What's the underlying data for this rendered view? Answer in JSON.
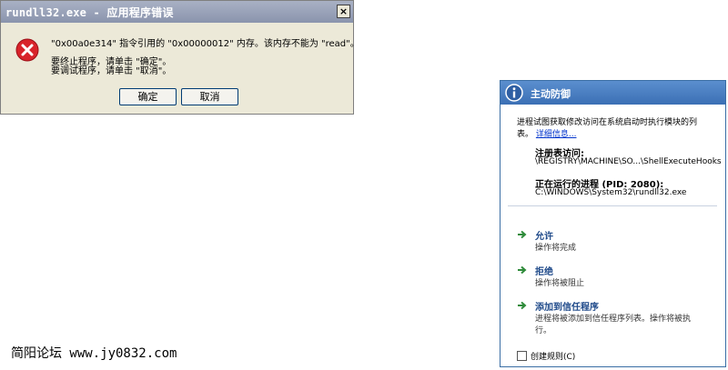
{
  "error_dialog": {
    "title": "rundll32.exe - 应用程序错误",
    "close_glyph": "×",
    "message": "\"0x00a0e314\" 指令引用的 \"0x00000012\" 内存。该内存不能为 \"read\"。",
    "line_terminate": "要终止程序，请单击 \"确定\"。",
    "line_debug": "要调试程序，请单击 \"取消\"。",
    "ok_label": "确定",
    "cancel_label": "取消",
    "icon": "error-x-icon",
    "icon_color": "#d8232a"
  },
  "watermark": {
    "text": "简阳论坛 www.jy0832.com"
  },
  "protection_panel": {
    "title": "主动防御",
    "header_color": "#3b6fb5",
    "description_line1": "进程试图获取修改访问在系统启动时执行模块的列",
    "description_line2": "表。",
    "details_link": "详细信息...",
    "registry_label": "注册表访问:",
    "registry_path": "\\REGISTRY\\MACHINE\\SO...\\ShellExecuteHooks",
    "process_label": "正在运行的进程  (PID: 2080):",
    "process_path": "C:\\WINDOWS\\System32\\rundll32.exe",
    "options": [
      {
        "title": "允许",
        "desc": "操作将完成"
      },
      {
        "title": "拒绝",
        "desc": "操作将被阻止"
      },
      {
        "title": "添加到信任程序",
        "desc": "进程将被添加到信任程序列表。操作将被执",
        "desc2": "行。"
      }
    ],
    "create_rule_label": "创建规则(C)",
    "create_rule_checked": false
  }
}
